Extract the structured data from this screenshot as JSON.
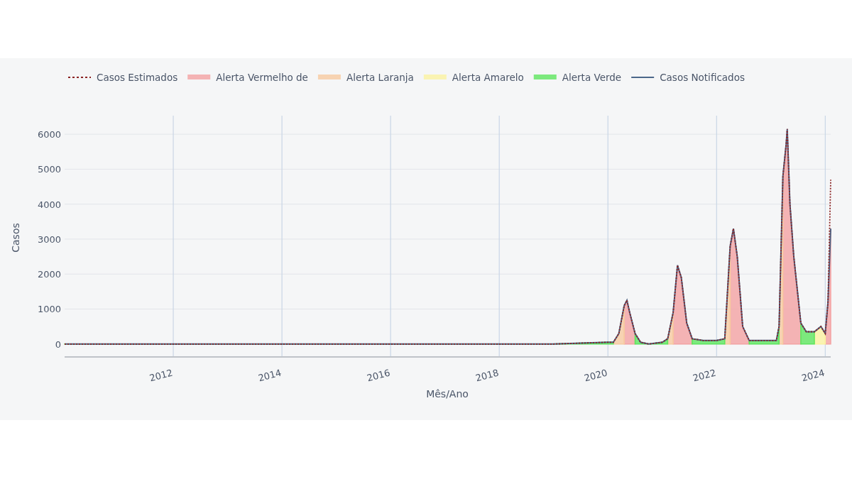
{
  "chart_data": {
    "type": "area",
    "grid": true,
    "legend": true,
    "xlabel": "Mês/Ano",
    "ylabel": "Casos",
    "xlim": [
      2010.0,
      2024.1
    ],
    "ylim": [
      -370,
      6530
    ],
    "xticks": [
      2012,
      2014,
      2016,
      2018,
      2020,
      2022,
      2024
    ],
    "yticks": [
      0,
      1000,
      2000,
      3000,
      4000,
      5000,
      6000
    ],
    "x": [
      2010.0,
      2011.0,
      2012.0,
      2013.0,
      2014.0,
      2015.0,
      2016.0,
      2017.0,
      2018.0,
      2019.0,
      2020.0,
      2020.1,
      2020.2,
      2020.3,
      2020.35,
      2020.4,
      2020.5,
      2020.6,
      2020.75,
      2021.0,
      2021.1,
      2021.2,
      2021.28,
      2021.35,
      2021.45,
      2021.55,
      2021.75,
      2022.0,
      2022.15,
      2022.25,
      2022.31,
      2022.38,
      2022.48,
      2022.6,
      2022.9,
      2023.1,
      2023.15,
      2023.22,
      2023.28,
      2023.3,
      2023.35,
      2023.42,
      2023.55,
      2023.65,
      2023.8,
      2023.92,
      2024.0,
      2024.05,
      2024.1
    ],
    "series": [
      {
        "name": "Casos Estimados",
        "type": "line",
        "line_style": "dot",
        "color": "#8b2323",
        "values": [
          0,
          0,
          0,
          0,
          0,
          0,
          0,
          0,
          0,
          0,
          50,
          50,
          300,
          1100,
          1250,
          900,
          300,
          50,
          0,
          50,
          150,
          900,
          2250,
          1900,
          600,
          150,
          100,
          100,
          150,
          2800,
          3300,
          2500,
          500,
          100,
          100,
          100,
          500,
          4800,
          5700,
          6150,
          4000,
          2500,
          600,
          350,
          350,
          500,
          300,
          1200,
          4700
        ]
      },
      {
        "name": "Alerta Vermelho de",
        "type": "area",
        "color": "#f4a3a3",
        "values": [
          null,
          null,
          null,
          null,
          null,
          null,
          null,
          null,
          null,
          null,
          null,
          null,
          null,
          1100,
          1250,
          900,
          300,
          null,
          null,
          null,
          null,
          900,
          2250,
          1900,
          600,
          150,
          null,
          null,
          null,
          2800,
          3300,
          2500,
          500,
          100,
          null,
          null,
          null,
          4800,
          5700,
          6150,
          4000,
          2500,
          600,
          null,
          null,
          null,
          300,
          1200,
          3300
        ]
      },
      {
        "name": "Alerta Laranja",
        "type": "area",
        "color": "#f7cba0",
        "values": [
          null,
          null,
          null,
          null,
          null,
          null,
          null,
          null,
          null,
          null,
          null,
          50,
          300,
          1100,
          null,
          null,
          null,
          null,
          null,
          null,
          150,
          900,
          null,
          null,
          null,
          null,
          null,
          null,
          150,
          2800,
          null,
          null,
          null,
          null,
          null,
          null,
          500,
          4800,
          null,
          null,
          null,
          null,
          null,
          null,
          null,
          null,
          null,
          null,
          null
        ]
      },
      {
        "name": "Alerta Amarelo",
        "type": "area",
        "color": "#fbf3a0",
        "values": [
          null,
          null,
          null,
          null,
          null,
          null,
          null,
          null,
          null,
          null,
          null,
          null,
          null,
          null,
          null,
          null,
          null,
          null,
          null,
          null,
          null,
          null,
          null,
          null,
          null,
          null,
          null,
          null,
          null,
          null,
          null,
          null,
          null,
          null,
          null,
          null,
          null,
          null,
          null,
          null,
          null,
          null,
          null,
          null,
          350,
          500,
          300,
          null,
          null
        ]
      },
      {
        "name": "Alerta Verde",
        "type": "area",
        "color": "#5ee65e",
        "values": [
          0,
          0,
          0,
          0,
          0,
          0,
          0,
          0,
          0,
          0,
          50,
          50,
          null,
          null,
          null,
          null,
          300,
          50,
          0,
          50,
          150,
          null,
          null,
          null,
          null,
          150,
          100,
          100,
          150,
          null,
          null,
          null,
          null,
          100,
          100,
          100,
          500,
          null,
          null,
          null,
          null,
          null,
          600,
          350,
          350,
          null,
          null,
          null,
          null
        ]
      },
      {
        "name": "Casos Notificados",
        "type": "line",
        "color": "#4b6789",
        "values": [
          0,
          0,
          0,
          0,
          0,
          0,
          0,
          0,
          0,
          0,
          50,
          50,
          300,
          1100,
          1250,
          900,
          300,
          50,
          0,
          50,
          150,
          900,
          2250,
          1900,
          600,
          150,
          100,
          100,
          150,
          2800,
          3300,
          2500,
          500,
          100,
          100,
          100,
          500,
          4800,
          5700,
          6150,
          4000,
          2500,
          600,
          350,
          350,
          500,
          300,
          1200,
          3300
        ]
      }
    ]
  }
}
